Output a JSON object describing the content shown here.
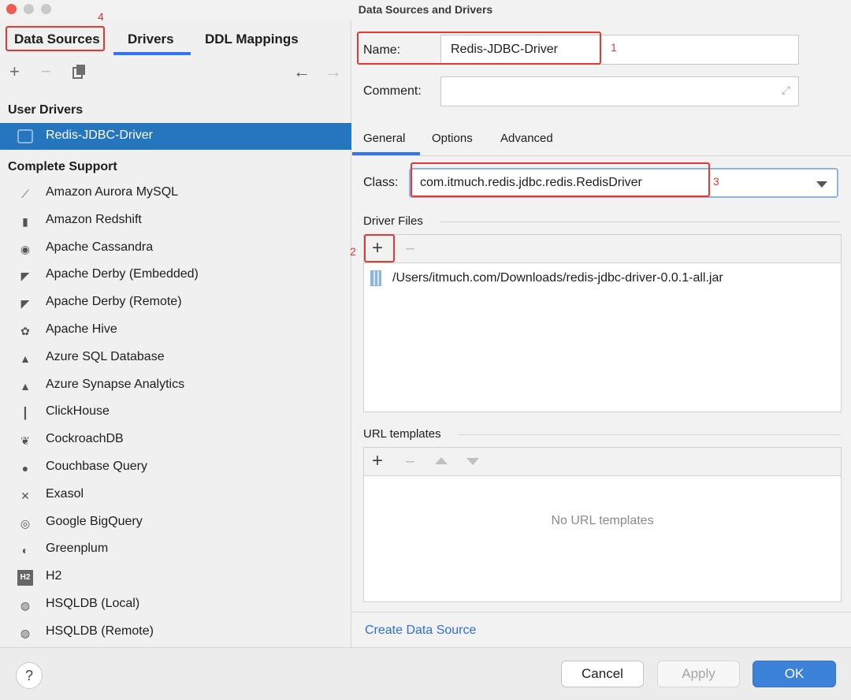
{
  "window": {
    "title": "Data Sources and Drivers"
  },
  "tabs": {
    "data_sources": "Data Sources",
    "drivers": "Drivers",
    "ddl_mappings": "DDL Mappings"
  },
  "sidebar": {
    "user_drivers_header": "User Drivers",
    "selected_driver": "Redis-JDBC-Driver",
    "complete_support_header": "Complete Support",
    "items": [
      {
        "label": "Amazon Aurora MySQL",
        "icon": "aurora-icon"
      },
      {
        "label": "Amazon Redshift",
        "icon": "redshift-icon"
      },
      {
        "label": "Apache Cassandra",
        "icon": "cassandra-icon"
      },
      {
        "label": "Apache Derby (Embedded)",
        "icon": "derby-icon"
      },
      {
        "label": "Apache Derby (Remote)",
        "icon": "derby-icon"
      },
      {
        "label": "Apache Hive",
        "icon": "hive-icon"
      },
      {
        "label": "Azure SQL Database",
        "icon": "azure-icon"
      },
      {
        "label": "Azure Synapse Analytics",
        "icon": "azure-icon"
      },
      {
        "label": "ClickHouse",
        "icon": "clickhouse-icon"
      },
      {
        "label": "CockroachDB",
        "icon": "cockroach-icon"
      },
      {
        "label": "Couchbase Query",
        "icon": "couchbase-icon"
      },
      {
        "label": "Exasol",
        "icon": "exasol-icon"
      },
      {
        "label": "Google BigQuery",
        "icon": "bigquery-icon"
      },
      {
        "label": "Greenplum",
        "icon": "greenplum-icon"
      },
      {
        "label": "H2",
        "icon": "h2-icon"
      },
      {
        "label": "HSQLDB (Local)",
        "icon": "hsqldb-icon"
      },
      {
        "label": "HSQLDB (Remote)",
        "icon": "hsqldb-icon"
      }
    ]
  },
  "form": {
    "name_label": "Name:",
    "name_value": "Redis-JDBC-Driver",
    "comment_label": "Comment:",
    "comment_value": "",
    "subtabs": [
      "General",
      "Options",
      "Advanced"
    ],
    "class_label": "Class:",
    "class_value": "com.itmuch.redis.jdbc.redis.RedisDriver",
    "driver_files_label": "Driver Files",
    "driver_file": "/Users/itmuch.com/Downloads/redis-jdbc-driver-0.0.1-all.jar",
    "url_templates_label": "URL templates",
    "url_empty": "No URL templates",
    "create_link": "Create Data Source"
  },
  "annotations": [
    "1",
    "2",
    "3",
    "4"
  ],
  "footer": {
    "help": "?",
    "cancel": "Cancel",
    "apply": "Apply",
    "ok": "OK"
  },
  "colors": {
    "accent": "#3574f0",
    "selection": "#2675bf",
    "annotation": "#e53935",
    "ok_button": "#3c82d8"
  }
}
